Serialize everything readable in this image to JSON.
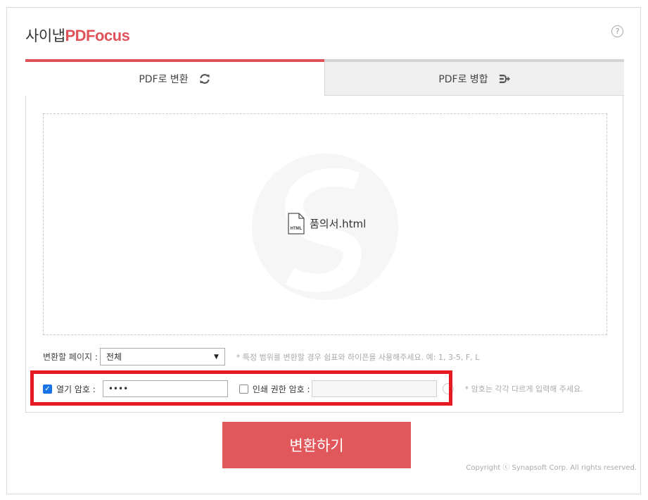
{
  "brand": {
    "prefix": "사이냅",
    "name": "PDFocus",
    "accent": "#e0525a"
  },
  "help": {
    "glyph": "?"
  },
  "tabs": [
    {
      "label": "PDF로 변환",
      "icon": "refresh-icon",
      "active": true
    },
    {
      "label": "PDF로 병합",
      "icon": "merge-icon",
      "active": false
    }
  ],
  "file": {
    "name": "품의서.html",
    "type_label": "HTML"
  },
  "page_range": {
    "label": "변환할 페이지 :",
    "selected": "전체",
    "hint": "* 특정 범위를 변환할 경우 쉼표와 하이픈을 사용해주세요. 예: 1, 3-5, F, L"
  },
  "passwords": {
    "open_label": "열기 암호 :",
    "open_checked": true,
    "open_value": "••••",
    "print_label": "인쇄 권한 암호 :",
    "print_checked": false,
    "print_value": "",
    "hint": "* 암호는 각각 다르게 입력해 주세요."
  },
  "submit_label": "변환하기",
  "copyright": "Copyright ⓒ Synapsoft Corp. All rights reserved.",
  "colors": {
    "accent": "#e0525a",
    "button": "#e0585c",
    "highlight": "#e5191f",
    "checkbox": "#1a73e8"
  }
}
